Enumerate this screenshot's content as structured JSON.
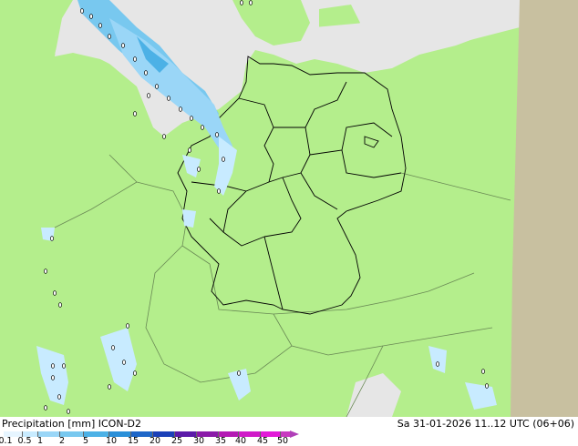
{
  "legend": {
    "title": "Precipitation [mm]  ICON-D2",
    "valid_time": "Sa 31-01-2026 11..12 UTC (06+06)",
    "ticks": [
      "0.1",
      "0.5",
      "1",
      "2",
      "5",
      "10",
      "15",
      "20",
      "25",
      "30",
      "35",
      "40",
      "45",
      "50"
    ],
    "colors": [
      "#e6f5ff",
      "#c8ebff",
      "#9ad6f7",
      "#78c8ef",
      "#4cb1e6",
      "#2a8fd8",
      "#1e66c8",
      "#1a40b8",
      "#5b1aa8",
      "#8a1aa8",
      "#b41ab4",
      "#d01ac8",
      "#e21ad8",
      "#c83ac0"
    ]
  },
  "map": {
    "land_color": "#b4ee8c",
    "sea_color": "#e6e6e6",
    "nodata_color": "#c8c0a0",
    "border_color": "#6a8a55",
    "state_border_color": "#000000"
  }
}
